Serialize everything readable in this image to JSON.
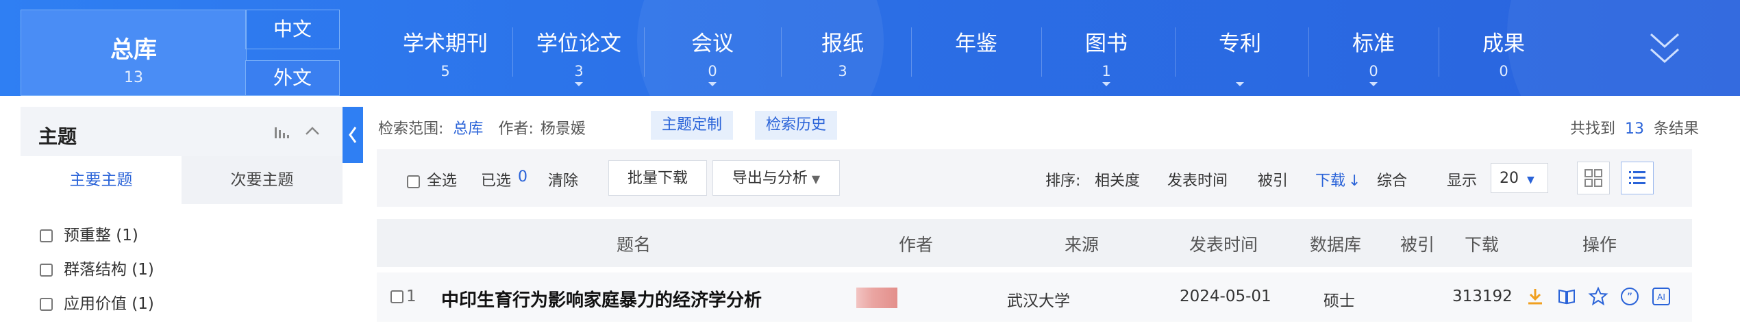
{
  "nav": {
    "main": {
      "label": "总库",
      "count": "13"
    },
    "lang_zh": "中文",
    "lang_foreign": "外文",
    "items": [
      {
        "label": "学术期刊",
        "count": "5"
      },
      {
        "label": "学位论文",
        "count": "3"
      },
      {
        "label": "会议",
        "count": "0"
      },
      {
        "label": "报纸",
        "count": "3"
      },
      {
        "label": "年鉴",
        "count": ""
      },
      {
        "label": "图书",
        "count": "1"
      },
      {
        "label": "专利",
        "count": ""
      },
      {
        "label": "标准",
        "count": "0"
      },
      {
        "label": "成果",
        "count": "0"
      }
    ],
    "expand_icon": "double-chevron-down-icon"
  },
  "sidebar": {
    "title": "主题",
    "tabs": [
      "主要主题",
      "次要主题"
    ],
    "facets": [
      "预重整 (1)",
      "群落结构 (1)",
      "应用价值 (1)"
    ]
  },
  "search": {
    "scope_label": "检索范围:",
    "scope_value": "总库",
    "author_label": "作者:",
    "author_value": "杨景媛",
    "topic_btn": "主题定制",
    "history_btn": "检索历史",
    "found_prefix": "共找到",
    "found_count": "13",
    "found_suffix": "条结果"
  },
  "toolbar": {
    "select_all": "全选",
    "selected_label": "已选",
    "selected_count": "0",
    "clear": "清除",
    "batch_download": "批量下载",
    "export": "导出与分析",
    "sort_label": "排序:",
    "sort_options": [
      "相关度",
      "发表时间",
      "被引",
      "下载",
      "综合"
    ],
    "display_label": "显示",
    "display_value": "20"
  },
  "table": {
    "headers": [
      "题名",
      "作者",
      "来源",
      "发表时间",
      "数据库",
      "被引",
      "下载",
      "操作"
    ],
    "rows": [
      {
        "index": "1",
        "title": "中印生育行为影响家庭暴力的经济学分析",
        "source": "武汉大学",
        "date": "2024-05-01",
        "db": "硕士",
        "cited": "",
        "downloads": "313192"
      }
    ]
  },
  "colors": {
    "accent": "#2a63d8",
    "nav_bg": "#2f7ff3",
    "download_icon": "#f0a020"
  }
}
